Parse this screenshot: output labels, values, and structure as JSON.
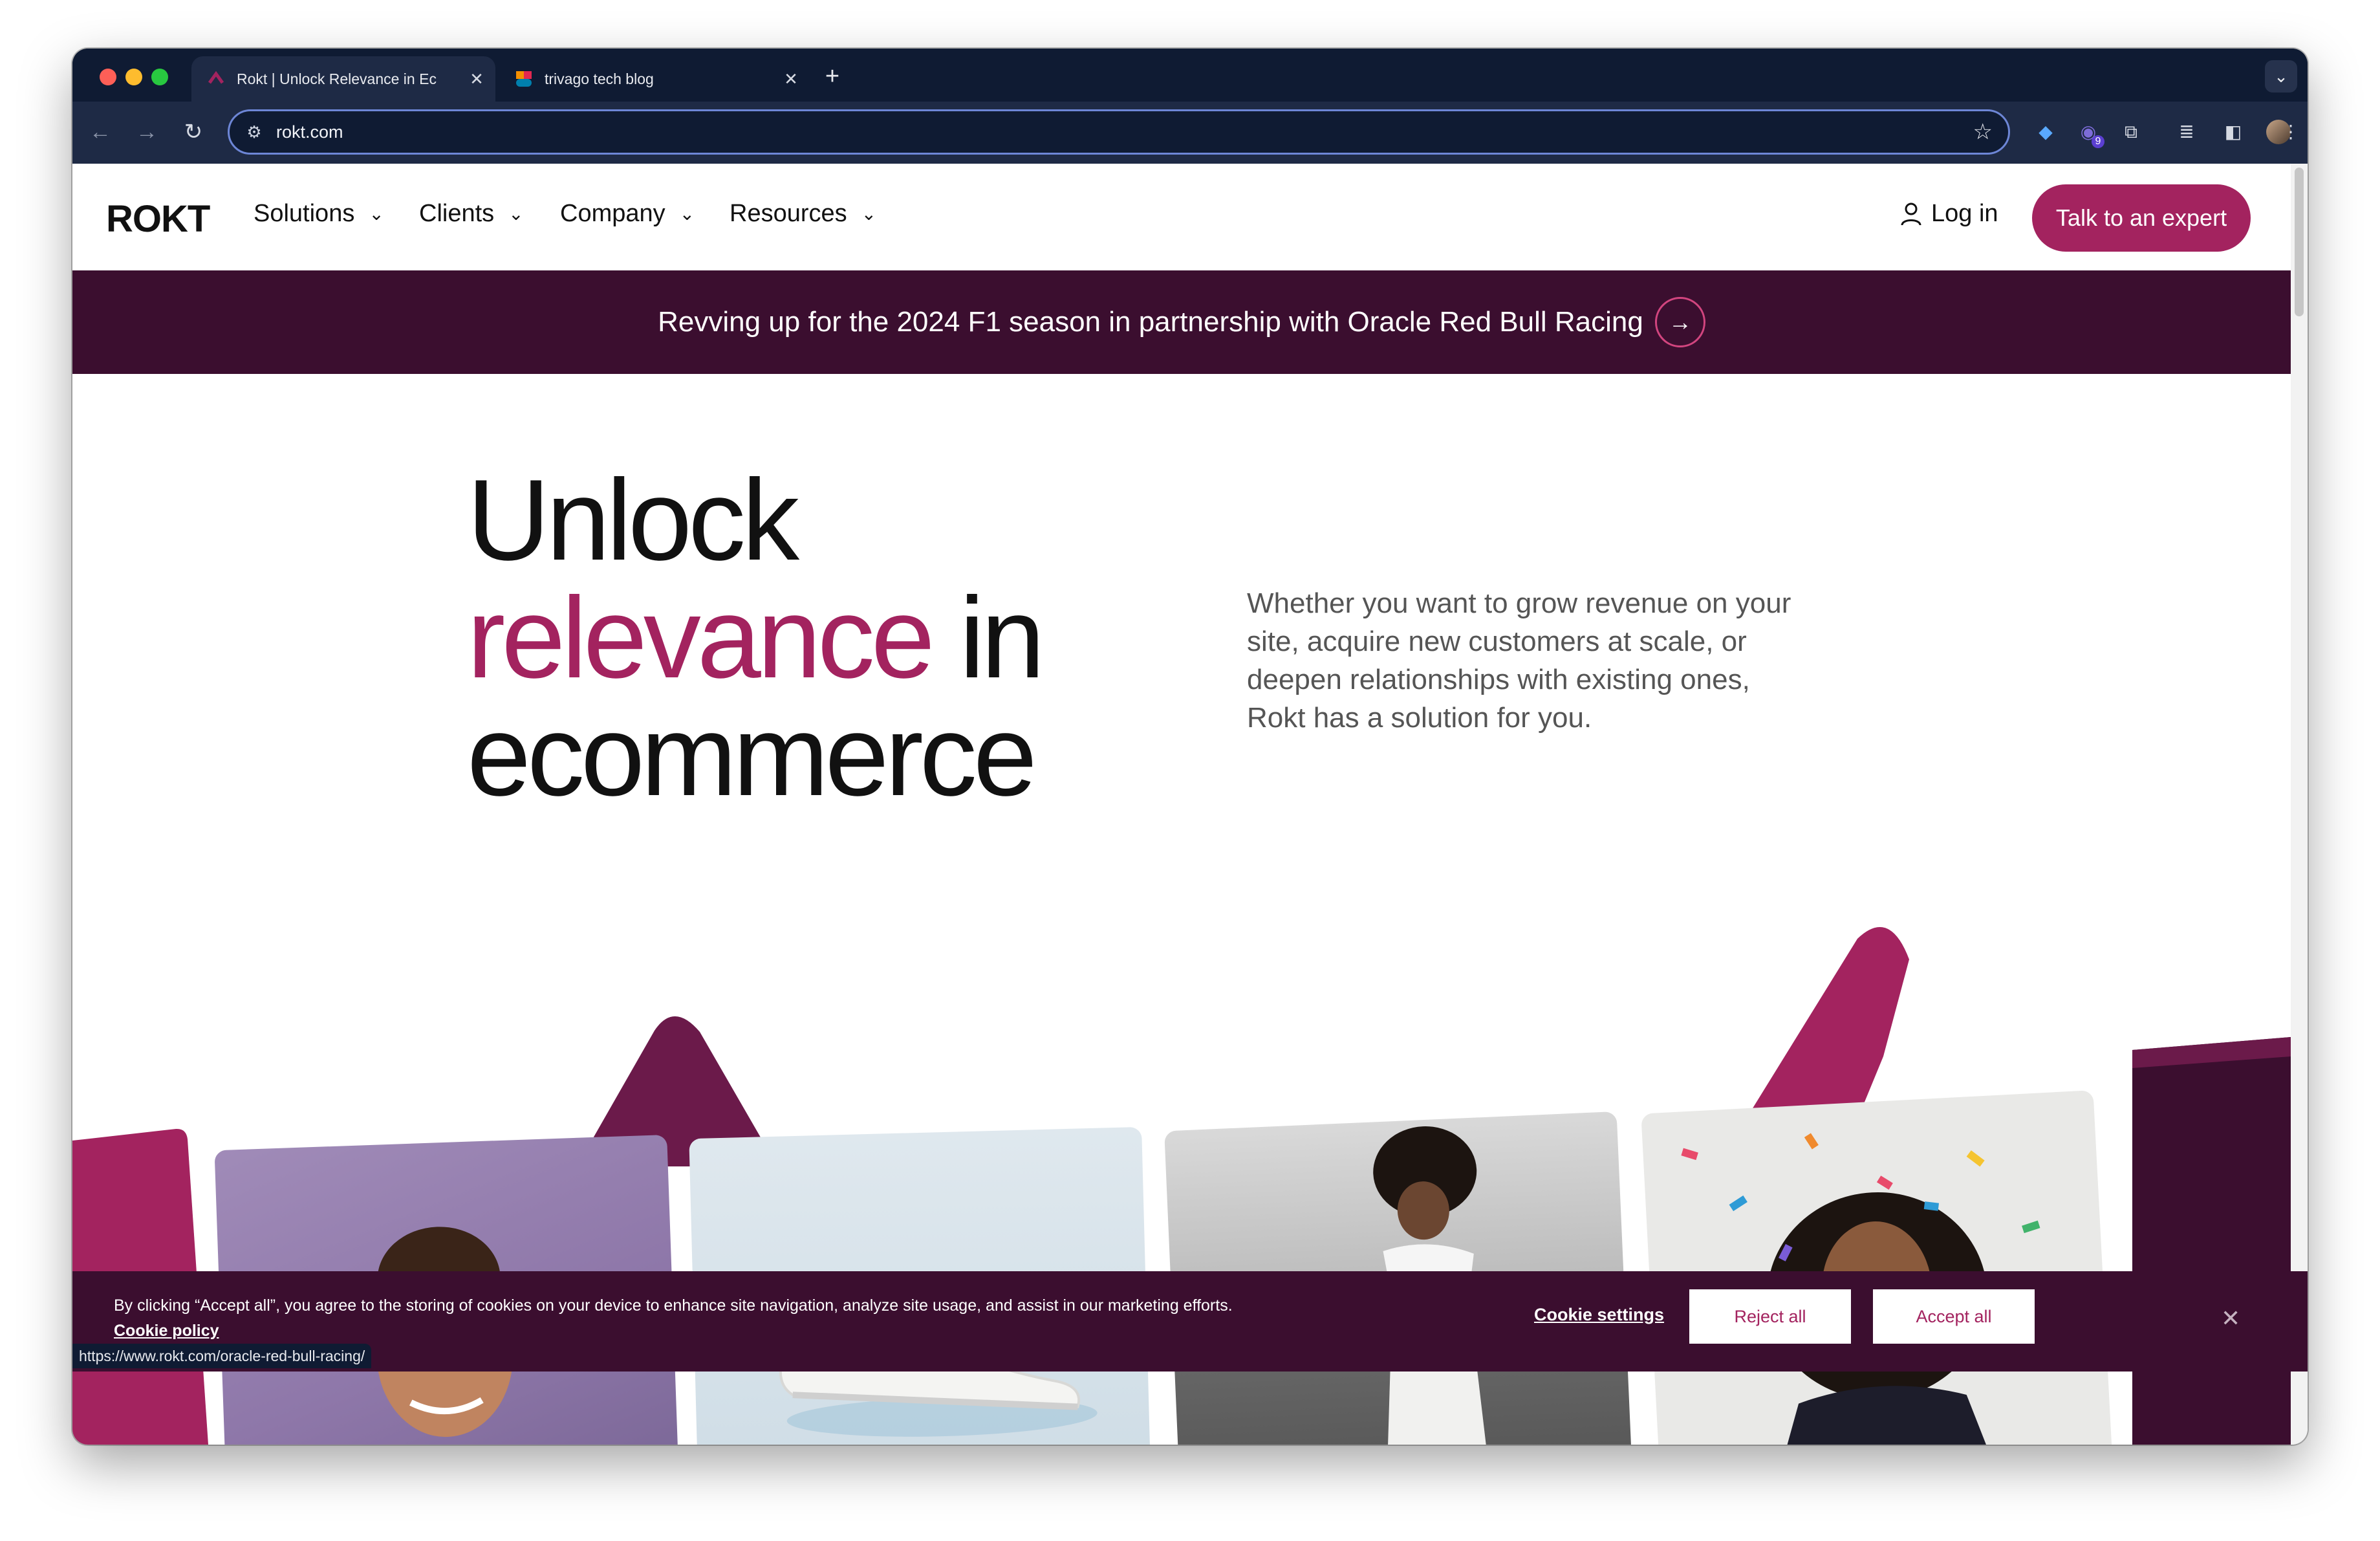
{
  "browser": {
    "tabs": [
      {
        "title": "Rokt | Unlock Relevance in Ec",
        "active": true
      },
      {
        "title": "trivago tech blog",
        "active": false
      }
    ],
    "close_glyph": "✕",
    "new_tab_glyph": "+",
    "url": "rokt.com",
    "extension_badge": "9",
    "status_url": "https://www.rokt.com/oracle-red-bull-racing/"
  },
  "site": {
    "logo": "ROKT",
    "nav": [
      "Solutions",
      "Clients",
      "Company",
      "Resources"
    ],
    "login": "Log in",
    "cta": "Talk to an expert",
    "announcement": "Revving up for the 2024 F1 season in partnership with Oracle Red Bull Racing"
  },
  "hero": {
    "line1": "Unlock",
    "accent": "relevance",
    "line2_rest": " in",
    "line3": "ecommerce",
    "copy": "Whether you want to grow revenue on your site, acquire new customers at scale, or deepen relationships with existing ones, Rokt has a solution for you."
  },
  "cookie": {
    "message": "By clicking “Accept all”, you agree to the storing of cookies on your device to enhance site navigation, analyze site usage, and assist in our marketing efforts.",
    "policy": "Cookie policy",
    "settings": "Cookie settings",
    "reject": "Reject all",
    "accept": "Accept all"
  },
  "colors": {
    "brand": "#a3235f",
    "dark_plum": "#3b0e2f",
    "browser_chrome": "#0f1b33"
  }
}
